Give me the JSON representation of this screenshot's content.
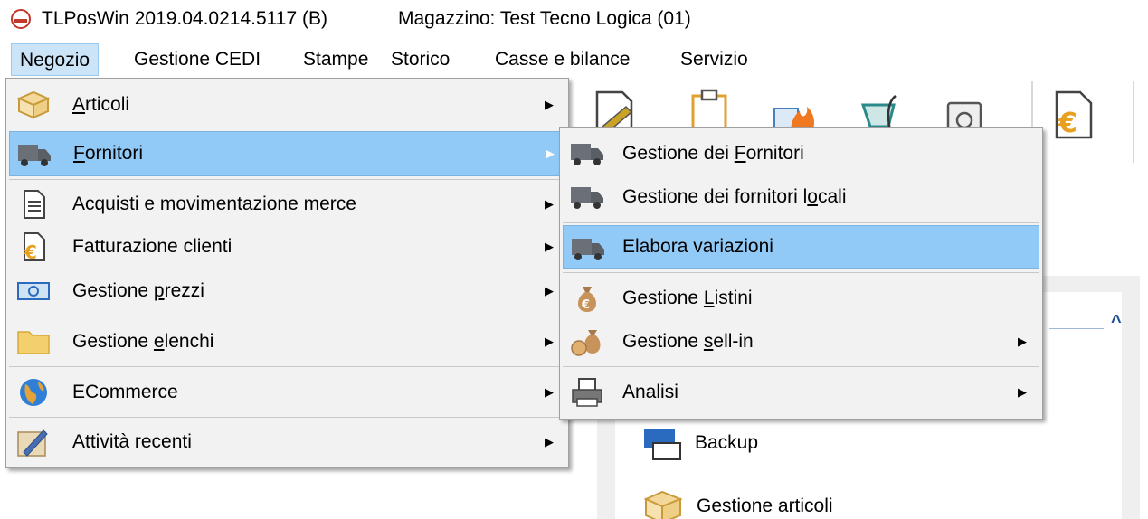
{
  "window": {
    "title": "TLPosWin 2019.04.0214.5117 (B)",
    "store": "Magazzino: Test Tecno Logica (01)"
  },
  "menubar": [
    {
      "label": "Negozio"
    },
    {
      "label": "Gestione CEDI"
    },
    {
      "label": "Stampe"
    },
    {
      "label": "Storico"
    },
    {
      "label": "Casse e bilance"
    },
    {
      "label": "Servizio"
    }
  ],
  "menu_negozio": {
    "items": [
      {
        "pre": "",
        "ul": "A",
        "post": "rticoli",
        "icon": "box-icon",
        "submenu": true
      },
      {
        "pre": "",
        "ul": "F",
        "post": "ornitori",
        "icon": "truck-icon",
        "submenu": true
      },
      {
        "pre": "Acquisti e movimentazione merce",
        "ul": "",
        "post": "",
        "icon": "document-icon",
        "submenu": true
      },
      {
        "pre": "Fatturazione clienti",
        "ul": "",
        "post": "",
        "icon": "invoice-euro-icon",
        "submenu": true
      },
      {
        "pre": "Gestione ",
        "ul": "p",
        "post": "rezzi",
        "icon": "banknote-icon",
        "submenu": true
      },
      {
        "pre": "Gestione ",
        "ul": "e",
        "post": "lenchi",
        "icon": "folder-icon",
        "submenu": true
      },
      {
        "pre": "ECommerce",
        "ul": "",
        "post": "",
        "icon": "globe-icon",
        "submenu": true
      },
      {
        "pre": "Attività recenti",
        "ul": "",
        "post": "",
        "icon": "pen-icon",
        "submenu": true
      }
    ]
  },
  "menu_fornitori": {
    "items": [
      {
        "pre": "Gestione dei ",
        "ul": "F",
        "post": "ornitori",
        "icon": "truck-icon",
        "submenu": false
      },
      {
        "pre": "Gestione dei fornitori l",
        "ul": "o",
        "post": "cali",
        "icon": "truck-icon",
        "submenu": false
      },
      {
        "pre": "Elabora variazioni",
        "ul": "",
        "post": "",
        "icon": "truck-icon",
        "submenu": false
      },
      {
        "pre": "Gestione ",
        "ul": "L",
        "post": "istini",
        "icon": "money-bag-icon",
        "submenu": false
      },
      {
        "pre": "Gestione ",
        "ul": "s",
        "post": "ell-in",
        "icon": "money-bags-icon",
        "submenu": true
      },
      {
        "pre": "Analisi",
        "ul": "",
        "post": "",
        "icon": "printer-icon",
        "submenu": true
      }
    ]
  },
  "panel": {
    "items": [
      {
        "label": "Backup",
        "icon": "backup-icon"
      },
      {
        "label": "Gestione articoli",
        "icon": "box-icon"
      }
    ]
  },
  "colors": {
    "menu_bg": "#f2f2f2",
    "highlight": "#91c9f7",
    "menubar_active": "#cce4f7"
  }
}
